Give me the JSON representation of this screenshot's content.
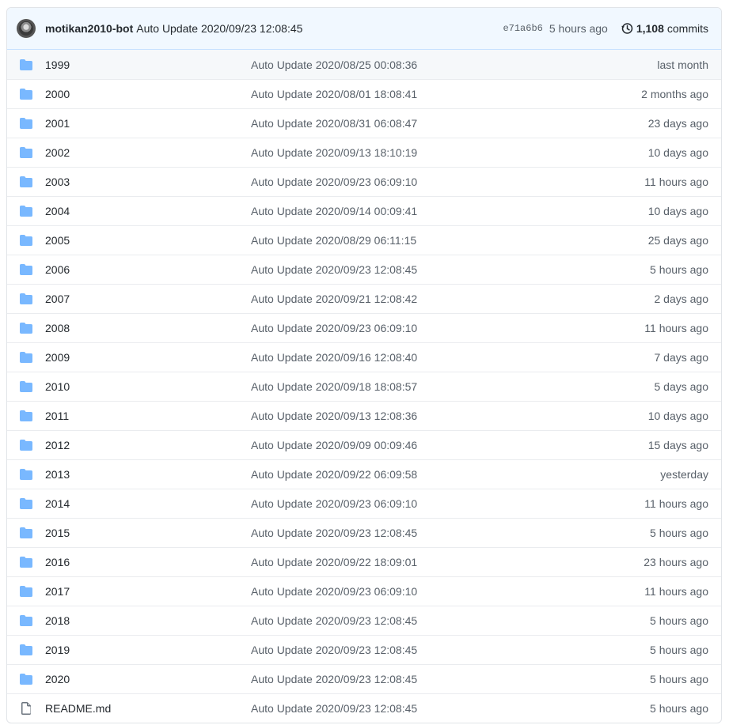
{
  "commit": {
    "author": "motikan2010-bot",
    "message": "Auto Update 2020/09/23 12:08:45",
    "sha": "e71a6b6",
    "age": "5 hours ago",
    "commit_count": "1,108",
    "commits_label": "commits"
  },
  "files": [
    {
      "name": "1999",
      "type": "dir",
      "message": "Auto Update 2020/08/25 00:08:36",
      "age": "last month"
    },
    {
      "name": "2000",
      "type": "dir",
      "message": "Auto Update 2020/08/01 18:08:41",
      "age": "2 months ago"
    },
    {
      "name": "2001",
      "type": "dir",
      "message": "Auto Update 2020/08/31 06:08:47",
      "age": "23 days ago"
    },
    {
      "name": "2002",
      "type": "dir",
      "message": "Auto Update 2020/09/13 18:10:19",
      "age": "10 days ago"
    },
    {
      "name": "2003",
      "type": "dir",
      "message": "Auto Update 2020/09/23 06:09:10",
      "age": "11 hours ago"
    },
    {
      "name": "2004",
      "type": "dir",
      "message": "Auto Update 2020/09/14 00:09:41",
      "age": "10 days ago"
    },
    {
      "name": "2005",
      "type": "dir",
      "message": "Auto Update 2020/08/29 06:11:15",
      "age": "25 days ago"
    },
    {
      "name": "2006",
      "type": "dir",
      "message": "Auto Update 2020/09/23 12:08:45",
      "age": "5 hours ago"
    },
    {
      "name": "2007",
      "type": "dir",
      "message": "Auto Update 2020/09/21 12:08:42",
      "age": "2 days ago"
    },
    {
      "name": "2008",
      "type": "dir",
      "message": "Auto Update 2020/09/23 06:09:10",
      "age": "11 hours ago"
    },
    {
      "name": "2009",
      "type": "dir",
      "message": "Auto Update 2020/09/16 12:08:40",
      "age": "7 days ago"
    },
    {
      "name": "2010",
      "type": "dir",
      "message": "Auto Update 2020/09/18 18:08:57",
      "age": "5 days ago"
    },
    {
      "name": "2011",
      "type": "dir",
      "message": "Auto Update 2020/09/13 12:08:36",
      "age": "10 days ago"
    },
    {
      "name": "2012",
      "type": "dir",
      "message": "Auto Update 2020/09/09 00:09:46",
      "age": "15 days ago"
    },
    {
      "name": "2013",
      "type": "dir",
      "message": "Auto Update 2020/09/22 06:09:58",
      "age": "yesterday"
    },
    {
      "name": "2014",
      "type": "dir",
      "message": "Auto Update 2020/09/23 06:09:10",
      "age": "11 hours ago"
    },
    {
      "name": "2015",
      "type": "dir",
      "message": "Auto Update 2020/09/23 12:08:45",
      "age": "5 hours ago"
    },
    {
      "name": "2016",
      "type": "dir",
      "message": "Auto Update 2020/09/22 18:09:01",
      "age": "23 hours ago"
    },
    {
      "name": "2017",
      "type": "dir",
      "message": "Auto Update 2020/09/23 06:09:10",
      "age": "11 hours ago"
    },
    {
      "name": "2018",
      "type": "dir",
      "message": "Auto Update 2020/09/23 12:08:45",
      "age": "5 hours ago"
    },
    {
      "name": "2019",
      "type": "dir",
      "message": "Auto Update 2020/09/23 12:08:45",
      "age": "5 hours ago"
    },
    {
      "name": "2020",
      "type": "dir",
      "message": "Auto Update 2020/09/23 12:08:45",
      "age": "5 hours ago"
    },
    {
      "name": "README.md",
      "type": "file",
      "message": "Auto Update 2020/09/23 12:08:45",
      "age": "5 hours ago"
    }
  ],
  "icons": {
    "dir": "folder-icon",
    "file": "file-icon",
    "history": "history-icon"
  },
  "colors": {
    "folder": "#79b8ff",
    "header_bg": "#f1f8ff",
    "muted": "#586069"
  }
}
